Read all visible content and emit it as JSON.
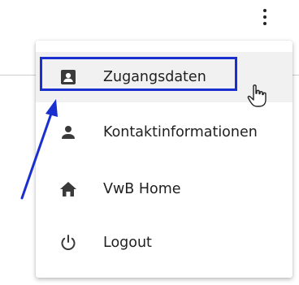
{
  "toolbar": {
    "more_icon": "vertical-ellipsis"
  },
  "menu": {
    "items": [
      {
        "label": "Zugangsdaten",
        "icon": "account-box",
        "hovered": true
      },
      {
        "label": "Kontaktinformationen",
        "icon": "person"
      },
      {
        "label": "VwB Home",
        "icon": "home"
      },
      {
        "label": "Logout",
        "icon": "power"
      }
    ]
  },
  "annotation": {
    "color": "#1a2fd0",
    "cursor_icon": "hand-pointer"
  }
}
